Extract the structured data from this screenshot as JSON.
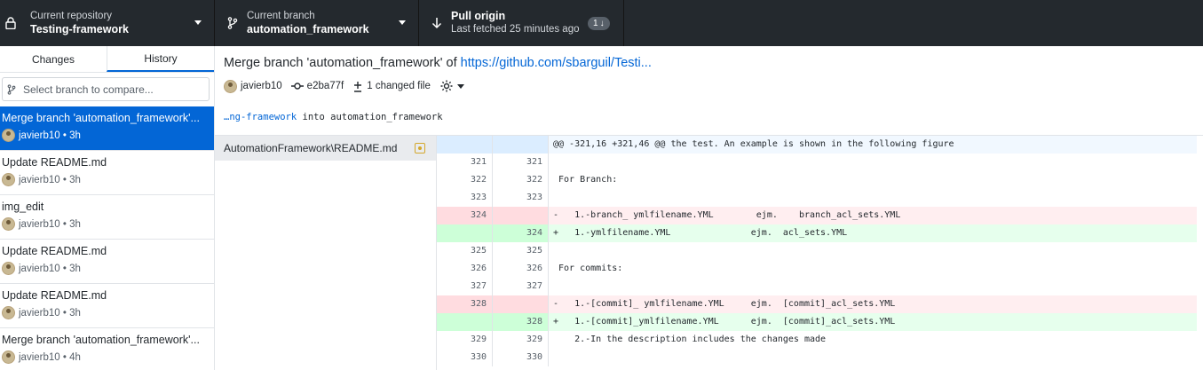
{
  "toolbar": {
    "repo_label": "Current repository",
    "repo_value": "Testing-framework",
    "branch_label": "Current branch",
    "branch_value": "automation_framework",
    "pull_label": "Pull origin",
    "pull_sub": "Last fetched 25 minutes ago",
    "pull_badge": "1"
  },
  "sidebar": {
    "tabs": [
      "Changes",
      "History"
    ],
    "active_tab": "History",
    "branch_filter_placeholder": "Select branch to compare...",
    "commits": [
      {
        "title": "Merge branch 'automation_framework'...",
        "meta": "javierb10 • 3h",
        "selected": true
      },
      {
        "title": "Update README.md",
        "meta": "javierb10 • 3h"
      },
      {
        "title": "img_edit",
        "meta": "javierb10 • 3h"
      },
      {
        "title": "Update README.md",
        "meta": "javierb10 • 3h"
      },
      {
        "title": "Update README.md",
        "meta": "javierb10 • 3h"
      },
      {
        "title": "Merge branch 'automation_framework'...",
        "meta": "javierb10 • 4h"
      }
    ]
  },
  "commit": {
    "title_prefix": "Merge branch 'automation_framework' of ",
    "title_link": "https://github.com/sbarguil/Testi...",
    "author": "javierb10",
    "sha": "e2ba77f",
    "changed": "1 changed file",
    "desc_ellipsis": "…ng-framework",
    "desc_rest": " into automation_framework"
  },
  "files": [
    {
      "name": "AutomationFramework\\README.md",
      "status": "modified"
    }
  ],
  "diff": {
    "hunk_header": "@@ -321,16 +321,46 @@ the test. An example is shown in the following figure",
    "rows": [
      {
        "type": "ctx",
        "old": "321",
        "new": "321",
        "text": ""
      },
      {
        "type": "ctx",
        "old": "322",
        "new": "322",
        "text": " For Branch:"
      },
      {
        "type": "ctx",
        "old": "323",
        "new": "323",
        "text": ""
      },
      {
        "type": "del",
        "old": "324",
        "new": "",
        "text": "-   1.-branch_ ymlfilename.YML        ejm.    branch_acl_sets.YML"
      },
      {
        "type": "add",
        "old": "",
        "new": "324",
        "text": "+   1.-ymlfilename.YML               ejm.  acl_sets.YML"
      },
      {
        "type": "ctx",
        "old": "325",
        "new": "325",
        "text": ""
      },
      {
        "type": "ctx",
        "old": "326",
        "new": "326",
        "text": " For commits:"
      },
      {
        "type": "ctx",
        "old": "327",
        "new": "327",
        "text": ""
      },
      {
        "type": "del",
        "old": "328",
        "new": "",
        "text": "-   1.-[commit]_ ymlfilename.YML     ejm.  [commit]_acl_sets.YML"
      },
      {
        "type": "add",
        "old": "",
        "new": "328",
        "text": "+   1.-[commit]_ymlfilename.YML      ejm.  [commit]_acl_sets.YML"
      },
      {
        "type": "ctx",
        "old": "329",
        "new": "329",
        "text": "    2.-In the description includes the changes made"
      },
      {
        "type": "ctx",
        "old": "330",
        "new": "330",
        "text": ""
      }
    ]
  }
}
